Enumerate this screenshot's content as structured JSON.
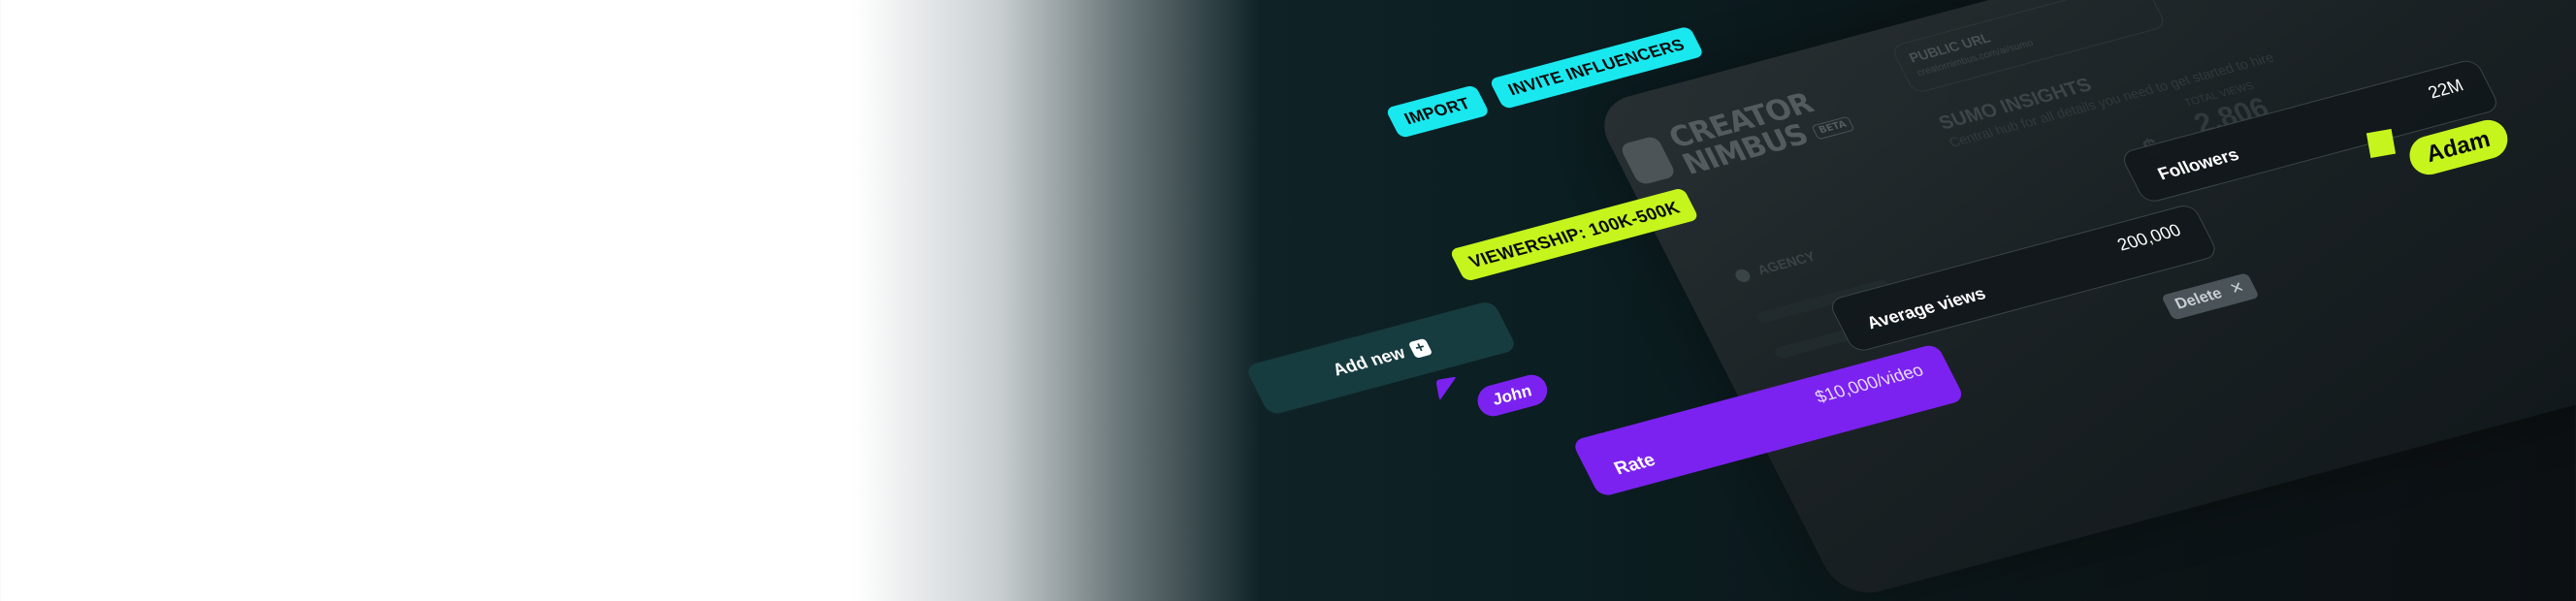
{
  "toolbar": {
    "import_label": "IMPORT",
    "invite_label": "INVITE INFLUENCERS"
  },
  "filter_chip": {
    "label": "VIEWERSHIP: 100K-500K"
  },
  "add_new": {
    "label": "Add new",
    "icon": "plus-icon"
  },
  "cursors": {
    "john": "John",
    "adam": "Adam"
  },
  "fields": {
    "followers": {
      "label": "Followers",
      "value": "22M"
    },
    "average_views": {
      "label": "Average views",
      "value": "200,000"
    },
    "rate": {
      "label": "Rate",
      "value": "$10,000/video"
    }
  },
  "delete_button": {
    "label": "Delete",
    "icon": "close-icon"
  },
  "panel": {
    "logo_line1": "CREATOR",
    "logo_line2": "NIMBUS",
    "beta": "BETA",
    "public_url_label": "PUBLIC URL",
    "public_url_value": "creatornimbus.com/ai/sumo",
    "title": "SUMO INSIGHTS",
    "subtitle": "Central hub for all details you need to get started to hire",
    "nav_agency": "AGENCY",
    "stat_label": "TOTAL VIEWS",
    "stat_value": "2,806",
    "stat_currency": "$"
  },
  "colors": {
    "cyan": "#19e8ef",
    "lime": "#c5f51d",
    "purple": "#7b22f0",
    "teal_dark": "#173c3f"
  }
}
